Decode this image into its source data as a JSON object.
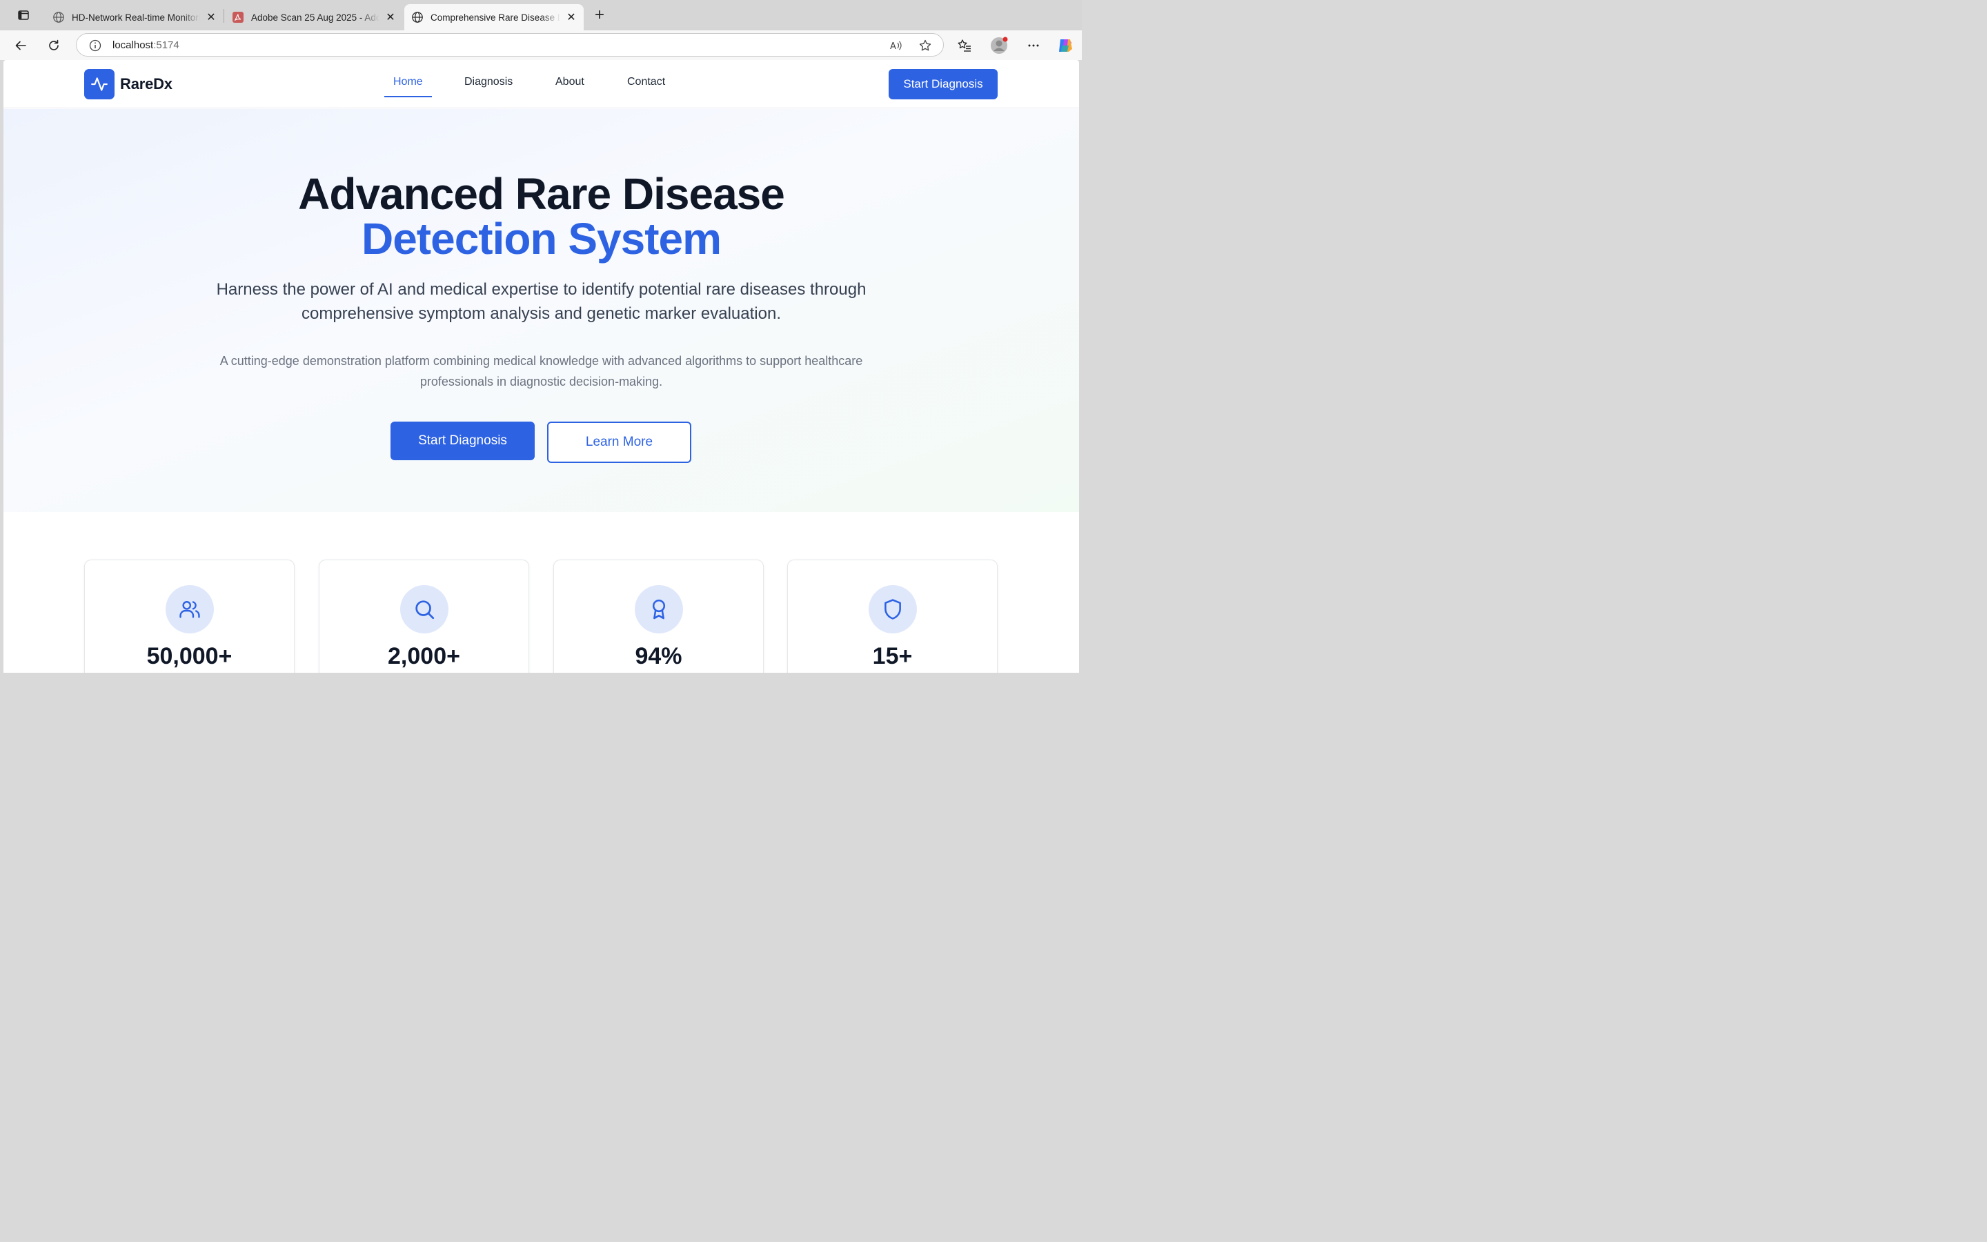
{
  "browser": {
    "tabs": [
      {
        "title": "HD-Network Real-time Monitoring",
        "favicon": "globe-icon",
        "active": false
      },
      {
        "title": "Adobe Scan 25 Aug 2025 - Adobe Acrobat",
        "favicon": "pdf-icon",
        "active": false
      },
      {
        "title": "Comprehensive Rare Disease Diagnosis",
        "favicon": "globe-icon",
        "active": true
      }
    ],
    "url_host": "localhost",
    "url_port": ":5174"
  },
  "site": {
    "brand": "RareDx",
    "nav": [
      {
        "label": "Home",
        "active": true
      },
      {
        "label": "Diagnosis",
        "active": false
      },
      {
        "label": "About",
        "active": false
      },
      {
        "label": "Contact",
        "active": false
      }
    ],
    "nav_cta": "Start Diagnosis"
  },
  "hero": {
    "title_line1": "Advanced Rare Disease",
    "title_line2": "Detection System",
    "lead": "Harness the power of AI and medical expertise to identify potential rare diseases through comprehensive symptom analysis and genetic marker evaluation.",
    "sub": "A cutting-edge demonstration platform combining medical knowledge with advanced algorithms to support healthcare professionals in diagnostic decision-making.",
    "primary_button": "Start Diagnosis",
    "secondary_button": "Learn More"
  },
  "stats": [
    {
      "value": "50,000+",
      "icon": "users-icon"
    },
    {
      "value": "2,000+",
      "icon": "search-icon"
    },
    {
      "value": "94%",
      "icon": "award-icon"
    },
    {
      "value": "15+",
      "icon": "shield-icon"
    }
  ],
  "colors": {
    "accent": "#2d62e3",
    "icon_circle": "#dfe8fb",
    "heading": "#101828"
  }
}
